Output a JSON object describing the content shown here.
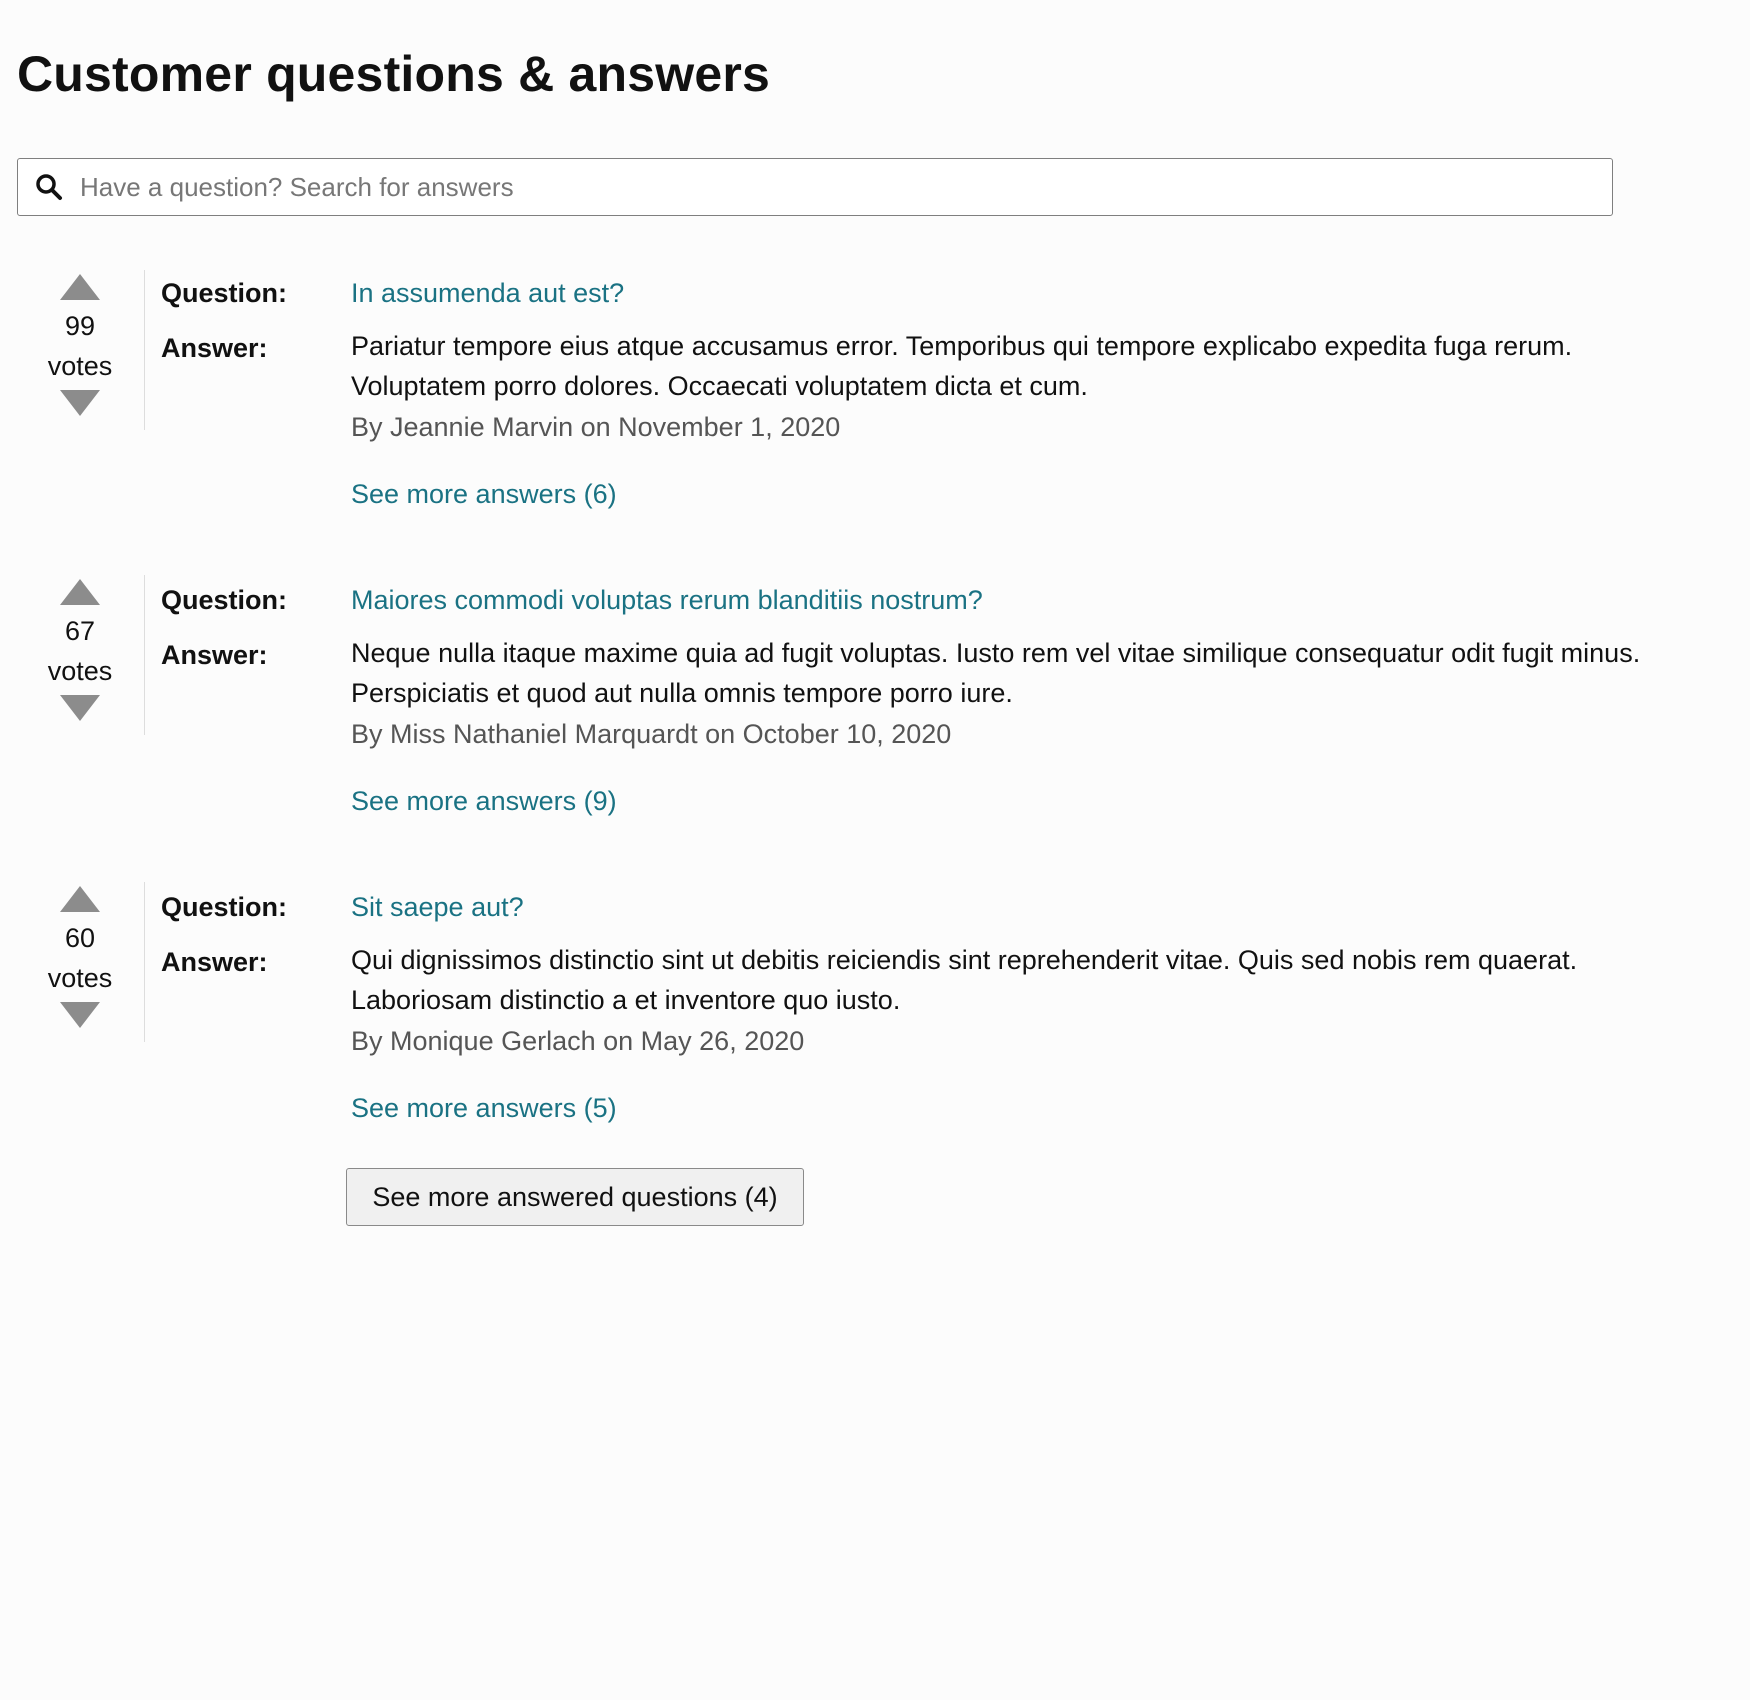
{
  "page": {
    "title": "Customer questions & answers"
  },
  "search": {
    "placeholder": "Have a question? Search for answers",
    "icon": "search-icon"
  },
  "labels": {
    "question": "Question:",
    "answer": "Answer:",
    "votes_unit": "votes"
  },
  "colors": {
    "link": "#1a7283",
    "vote_arrow": "#8c8c8c",
    "byline": "#555555"
  },
  "qa_items": [
    {
      "votes": "99",
      "question": "In assumenda aut est?",
      "answer": "Pariatur tempore eius atque accusamus error. Temporibus qui tempore explicabo expedita fuga rerum. Voluptatem porro dolores. Occaecati voluptatem dicta et cum.",
      "byline": "By Jeannie Marvin on November 1, 2020",
      "more_answers": "See more answers (6)"
    },
    {
      "votes": "67",
      "question": "Maiores commodi voluptas rerum blanditiis nostrum?",
      "answer": "Neque nulla itaque maxime quia ad fugit voluptas. Iusto rem vel vitae similique consequatur odit fugit minus. Perspiciatis et quod aut nulla omnis tempore porro iure.",
      "byline": "By Miss Nathaniel Marquardt on October 10, 2020",
      "more_answers": "See more answers (9)"
    },
    {
      "votes": "60",
      "question": "Sit saepe aut?",
      "answer": "Qui dignissimos distinctio sint ut debitis reiciendis sint reprehenderit vitae. Quis sed nobis rem quaerat. Laboriosam distinctio a et inventore quo iusto.",
      "byline": "By Monique Gerlach on May 26, 2020",
      "more_answers": "See more answers (5)"
    }
  ],
  "more_questions_button": "See more answered questions (4)"
}
